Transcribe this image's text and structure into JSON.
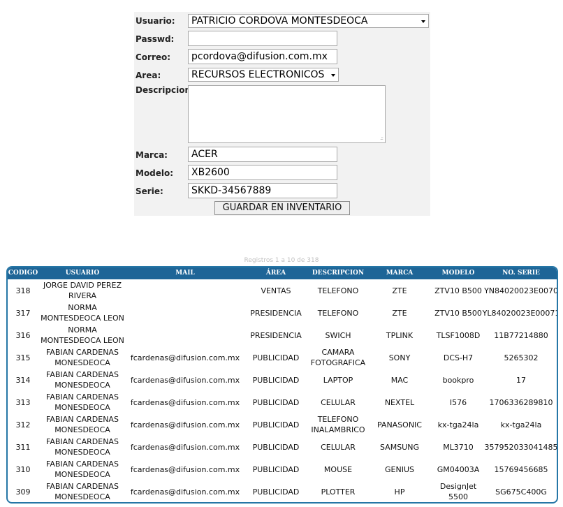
{
  "form": {
    "usuario_label": "Usuario:",
    "usuario_value": "PATRICIO CORDOVA MONTESDEOCA",
    "passwd_label": "Passwd:",
    "passwd_value": "",
    "correo_label": "Correo:",
    "correo_value": "pcordova@difusion.com.mx",
    "area_label": "Area:",
    "area_value": "RECURSOS ELECTRONICOS",
    "descripcion_label": "Descripcion:",
    "descripcion_value": "",
    "marca_label": "Marca:",
    "marca_value": "ACER",
    "modelo_label": "Modelo:",
    "modelo_value": "XB2600",
    "serie_label": "Serie:",
    "serie_value": "SKKD-34567889",
    "save_label": "GUARDAR EN INVENTARIO"
  },
  "table": {
    "records_info": "Registros 1 a 10 de 318",
    "headers": [
      "CODIGO",
      "USUARIO",
      "MAIL",
      "ÁREA",
      "DESCRIPCION",
      "MARCA",
      "MODELO",
      "NO. SERIE"
    ],
    "rows": [
      {
        "codigo": "318",
        "usuario": "JORGE DAVID PEREZ RIVERA",
        "mail": "",
        "area": "VENTAS",
        "descripcion": "TELEFONO",
        "marca": "ZTE",
        "modelo": "ZTV10 B500",
        "serie": "YN84020023E0070"
      },
      {
        "codigo": "317",
        "usuario": "NORMA MONTESDEOCA LEON",
        "mail": "",
        "area": "PRESIDENCIA",
        "descripcion": "TELEFONO",
        "marca": "ZTE",
        "modelo": "ZTV10 B500",
        "serie": "YL84020023E00071"
      },
      {
        "codigo": "316",
        "usuario": "NORMA MONTESDEOCA LEON",
        "mail": "",
        "area": "PRESIDENCIA",
        "descripcion": "SWICH",
        "marca": "TPLINK",
        "modelo": "TLSF1008D",
        "serie": "11B77214880"
      },
      {
        "codigo": "315",
        "usuario": "FABIAN CARDENAS MONESDEOCA",
        "mail": "fcardenas@difusion.com.mx",
        "area": "PUBLICIDAD",
        "descripcion": "CAMARA FOTOGRAFICA",
        "marca": "SONY",
        "modelo": "DCS-H7",
        "serie": "5265302"
      },
      {
        "codigo": "314",
        "usuario": "FABIAN CARDENAS MONESDEOCA",
        "mail": "fcardenas@difusion.com.mx",
        "area": "PUBLICIDAD",
        "descripcion": "LAPTOP",
        "marca": "MAC",
        "modelo": "bookpro",
        "serie": "17"
      },
      {
        "codigo": "313",
        "usuario": "FABIAN CARDENAS MONESDEOCA",
        "mail": "fcardenas@difusion.com.mx",
        "area": "PUBLICIDAD",
        "descripcion": "CELULAR",
        "marca": "NEXTEL",
        "modelo": "I576",
        "serie": "1706336289810"
      },
      {
        "codigo": "312",
        "usuario": "FABIAN CARDENAS MONESDEOCA",
        "mail": "fcardenas@difusion.com.mx",
        "area": "PUBLICIDAD",
        "descripcion": "TELEFONO INALAMBRICO",
        "marca": "PANASONIC",
        "modelo": "kx-tga24la",
        "serie": "kx-tga24la"
      },
      {
        "codigo": "311",
        "usuario": "FABIAN CARDENAS MONESDEOCA",
        "mail": "fcardenas@difusion.com.mx",
        "area": "PUBLICIDAD",
        "descripcion": "CELULAR",
        "marca": "SAMSUNG",
        "modelo": "ML3710",
        "serie": "357952033041485"
      },
      {
        "codigo": "310",
        "usuario": "FABIAN CARDENAS MONESDEOCA",
        "mail": "fcardenas@difusion.com.mx",
        "area": "PUBLICIDAD",
        "descripcion": "MOUSE",
        "marca": "GENIUS",
        "modelo": "GM04003A",
        "serie": "15769456685"
      },
      {
        "codigo": "309",
        "usuario": "FABIAN CARDENAS MONESDEOCA",
        "mail": "fcardenas@difusion.com.mx",
        "area": "PUBLICIDAD",
        "descripcion": "PLOTTER",
        "marca": "HP",
        "modelo": "DesignJet 5500",
        "serie": "SG675C400G"
      }
    ]
  },
  "colors": {
    "header_bg": "#1e6597",
    "frame_border": "#2576a6",
    "form_bg": "#f2f2f2"
  },
  "icons": {
    "select_arrow": "chevron-down-icon",
    "resize_grip": "resize-grip-icon"
  }
}
